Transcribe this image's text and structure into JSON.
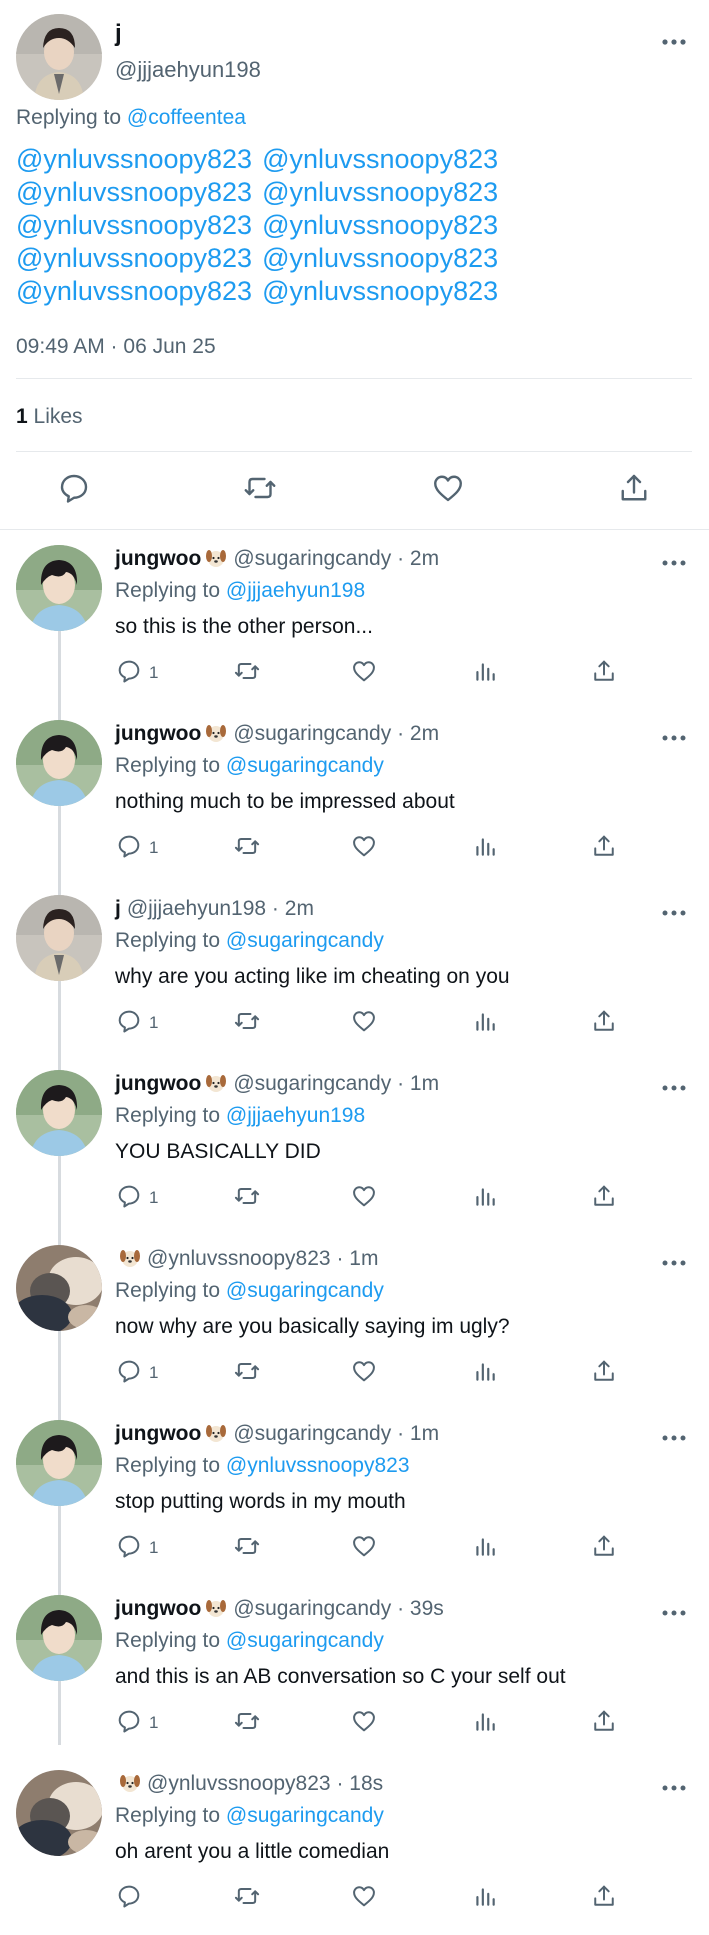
{
  "main_tweet": {
    "name": "j",
    "handle": "@jjjaehyun198",
    "replying_prefix": "Replying to",
    "replying_to": "@coffeentea",
    "mentions": [
      "@ynluvssnoopy823",
      "@ynluvssnoopy823",
      "@ynluvssnoopy823",
      "@ynluvssnoopy823",
      "@ynluvssnoopy823",
      "@ynluvssnoopy823",
      "@ynluvssnoopy823",
      "@ynluvssnoopy823",
      "@ynluvssnoopy823",
      "@ynluvssnoopy823"
    ],
    "timestamp": "09:49 AM · 06 Jun 25",
    "likes_count": "1",
    "likes_label": "Likes",
    "action_icons": [
      "reply-icon",
      "retweet-icon",
      "like-icon",
      "share-icon"
    ]
  },
  "replies": [
    {
      "name": "jungwoo",
      "emoji": true,
      "handle": "@sugaringcandy",
      "time": "2m",
      "replying_prefix": "Replying to",
      "replying_to": "@jjjaehyun198",
      "text": "so this is the other person...",
      "reply_count": "1",
      "avatar": "jungwoo"
    },
    {
      "name": "jungwoo",
      "emoji": true,
      "handle": "@sugaringcandy",
      "time": "2m",
      "replying_prefix": "Replying to",
      "replying_to": "@sugaringcandy",
      "text": "nothing much to be impressed about",
      "reply_count": "1",
      "avatar": "jungwoo"
    },
    {
      "name": "j",
      "emoji": false,
      "handle": "@jjjaehyun198",
      "time": "2m",
      "replying_prefix": "Replying to",
      "replying_to": "@sugaringcandy",
      "text": "why are you acting like im cheating on you",
      "reply_count": "1",
      "avatar": "j"
    },
    {
      "name": "jungwoo",
      "emoji": true,
      "handle": "@sugaringcandy",
      "time": "1m",
      "replying_prefix": "Replying to",
      "replying_to": "@jjjaehyun198",
      "text": "YOU BASICALLY DID",
      "reply_count": "1",
      "avatar": "jungwoo"
    },
    {
      "name": "",
      "emoji": true,
      "handle": "@ynluvssnoopy823",
      "time": "1m",
      "replying_prefix": "Replying to",
      "replying_to": "@sugaringcandy",
      "text": "now why are you basically saying im ugly?",
      "reply_count": "1",
      "avatar": "yn"
    },
    {
      "name": "jungwoo",
      "emoji": true,
      "handle": "@sugaringcandy",
      "time": "1m",
      "replying_prefix": "Replying to",
      "replying_to": "@ynluvssnoopy823",
      "text": "stop putting words in my mouth",
      "reply_count": "1",
      "avatar": "jungwoo"
    },
    {
      "name": "jungwoo",
      "emoji": true,
      "handle": "@sugaringcandy",
      "time": "39s",
      "replying_prefix": "Replying to",
      "replying_to": "@sugaringcandy",
      "text": "and this is an AB conversation so C your self out",
      "reply_count": "1",
      "avatar": "jungwoo"
    },
    {
      "name": "",
      "emoji": true,
      "handle": "@ynluvssnoopy823",
      "time": "18s",
      "replying_prefix": "Replying to",
      "replying_to": "@sugaringcandy",
      "text": "oh arent you a little comedian",
      "reply_count": "",
      "avatar": "yn"
    }
  ],
  "colors": {
    "link": "#1d9bf0",
    "secondary_text": "#536471",
    "primary_text": "#0f1419",
    "divider": "#e6e9ec"
  }
}
